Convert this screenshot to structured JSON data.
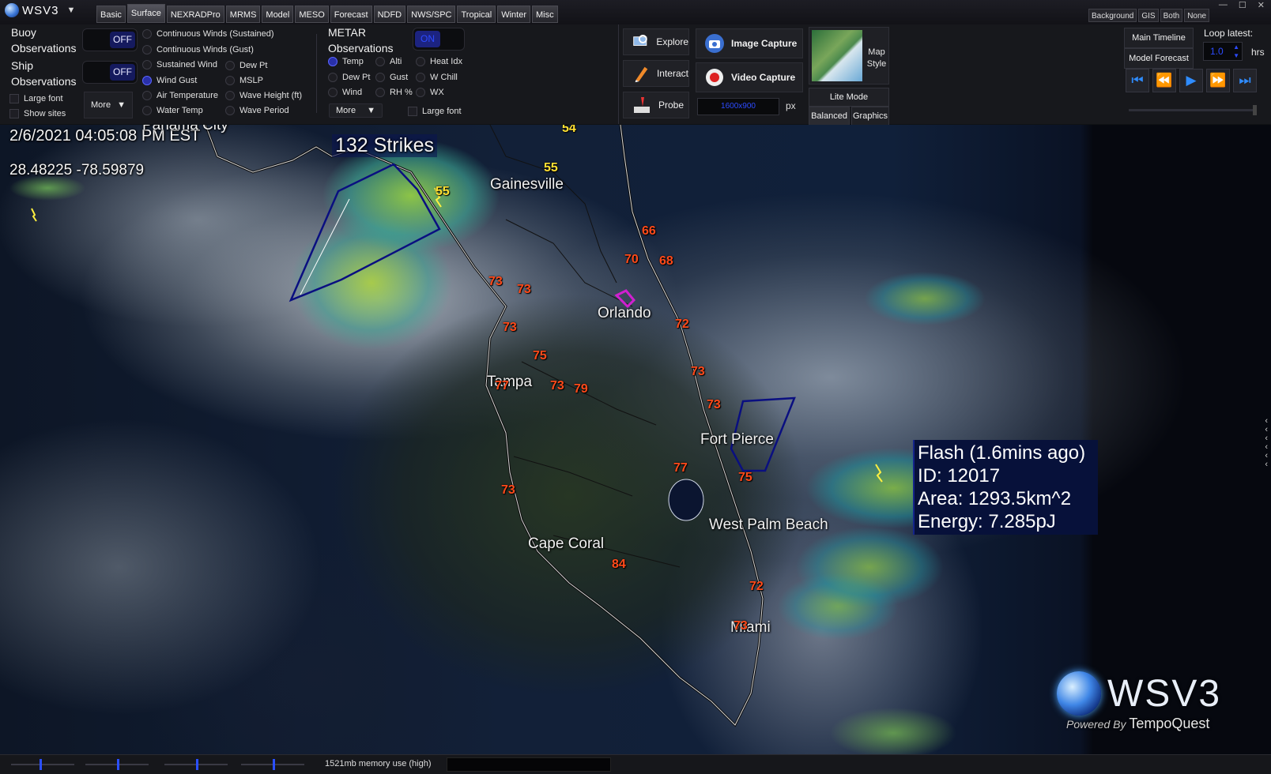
{
  "app": {
    "name": "WSV3",
    "caret": "▼"
  },
  "tabs": [
    {
      "label": "Basic"
    },
    {
      "label": "Surface",
      "active": true
    },
    {
      "label": "NEXRADPro"
    },
    {
      "label": "MRMS"
    },
    {
      "label": "Model"
    },
    {
      "label": "MESO"
    },
    {
      "label": "Forecast"
    },
    {
      "label": "NDFD"
    },
    {
      "label": "NWS/SPC"
    },
    {
      "label": "Tropical"
    },
    {
      "label": "Winter"
    },
    {
      "label": "Misc"
    }
  ],
  "bg_toggles": [
    "Background",
    "GIS",
    "Both",
    "None"
  ],
  "window_controls": [
    "—",
    "☐",
    "✕"
  ],
  "panel": {
    "buoy_label_1": "Buoy",
    "buoy_label_2": "Observations",
    "buoy_toggle": "OFF",
    "ship_label_1": "Ship",
    "ship_label_2": "Observations",
    "ship_toggle": "OFF",
    "large_font": "Large font",
    "show_sites": "Show sites",
    "more": "More",
    "surface_options": [
      {
        "label": "Continuous Winds (Sustained)",
        "selected": false
      },
      {
        "label": "Continuous Winds (Gust)",
        "selected": false
      },
      {
        "label": "Sustained Wind",
        "selected": false
      },
      {
        "label": "Dew Pt",
        "selected": false
      },
      {
        "label": "Wind Gust",
        "selected": true
      },
      {
        "label": "MSLP",
        "selected": false
      },
      {
        "label": "Air Temperature",
        "selected": false
      },
      {
        "label": "Wave Height (ft)",
        "selected": false
      },
      {
        "label": "Water Temp",
        "selected": false
      },
      {
        "label": "Wave Period",
        "selected": false
      }
    ],
    "metar_label_1": "METAR",
    "metar_label_2": "Observations",
    "metar_toggle": "ON",
    "metar_options": [
      {
        "label": "Temp",
        "selected": true
      },
      {
        "label": "Alti",
        "selected": false
      },
      {
        "label": "Heat Idx",
        "selected": false
      },
      {
        "label": "Dew Pt",
        "selected": false
      },
      {
        "label": "Gust",
        "selected": false
      },
      {
        "label": "W Chill",
        "selected": false
      },
      {
        "label": "Wind",
        "selected": false
      },
      {
        "label": "RH %",
        "selected": false
      },
      {
        "label": "WX",
        "selected": false
      }
    ],
    "metar_more": "More",
    "metar_large_font": "Large font"
  },
  "tools": {
    "explore": "Explore",
    "interact": "Interact",
    "probe": "Probe",
    "image_capture": "Image Capture",
    "video_capture": "Video Capture",
    "resolution_value": "1600x900",
    "px": "px",
    "map_style": "Map Style",
    "lite_mode": "Lite Mode",
    "balanced": "Balanced",
    "graphics": "Graphics"
  },
  "timeline": {
    "main": "Main Timeline",
    "model_forecast": "Model Forecast",
    "loop_latest": "Loop latest:",
    "loop_value": "1.0",
    "hrs": "hrs"
  },
  "map": {
    "datetime": "2/6/2021  04:05:08  PM  EST",
    "coords": "28.48225  -78.59879",
    "strikes": "132  Strikes",
    "flash": {
      "line1": "Flash  (1.6mins  ago)",
      "line2": "ID:  12017",
      "line3": "Area:  1293.5km^2",
      "line4": "Energy:  7.285pJ"
    },
    "cities": [
      {
        "name": "Panama  City",
        "id": "panama-city"
      },
      {
        "name": "Gainesville",
        "id": "gainesville"
      },
      {
        "name": "Orlando",
        "id": "orlando"
      },
      {
        "name": "Tampa",
        "id": "tampa"
      },
      {
        "name": "Fort  Pierce",
        "id": "fort-pierce"
      },
      {
        "name": "West  Palm  Beach",
        "id": "west-palm-beach"
      },
      {
        "name": "Cape  Coral",
        "id": "cape-coral"
      },
      {
        "name": "Miami",
        "id": "miami"
      }
    ],
    "temps": [
      {
        "v": "54",
        "c": "y"
      },
      {
        "v": "55",
        "c": "y"
      },
      {
        "v": "55",
        "c": "y"
      },
      {
        "v": "66",
        "c": "o"
      },
      {
        "v": "70",
        "c": "o"
      },
      {
        "v": "68",
        "c": "o"
      },
      {
        "v": "73",
        "c": "o"
      },
      {
        "v": "73",
        "c": "o"
      },
      {
        "v": "73",
        "c": "o"
      },
      {
        "v": "72",
        "c": "o"
      },
      {
        "v": "75",
        "c": "o"
      },
      {
        "v": "73",
        "c": "o"
      },
      {
        "v": "77",
        "c": "o"
      },
      {
        "v": "73",
        "c": "o"
      },
      {
        "v": "79",
        "c": "o"
      },
      {
        "v": "73",
        "c": "o"
      },
      {
        "v": "77",
        "c": "o"
      },
      {
        "v": "75",
        "c": "o"
      },
      {
        "v": "73",
        "c": "o"
      },
      {
        "v": "84",
        "c": "o"
      },
      {
        "v": "72",
        "c": "o"
      },
      {
        "v": "73",
        "c": "o"
      }
    ],
    "brand": {
      "name": "WSV3",
      "powered": "Powered By",
      "company": "TempoQuest"
    }
  },
  "status": {
    "memory": "1521mb memory use (high)"
  }
}
